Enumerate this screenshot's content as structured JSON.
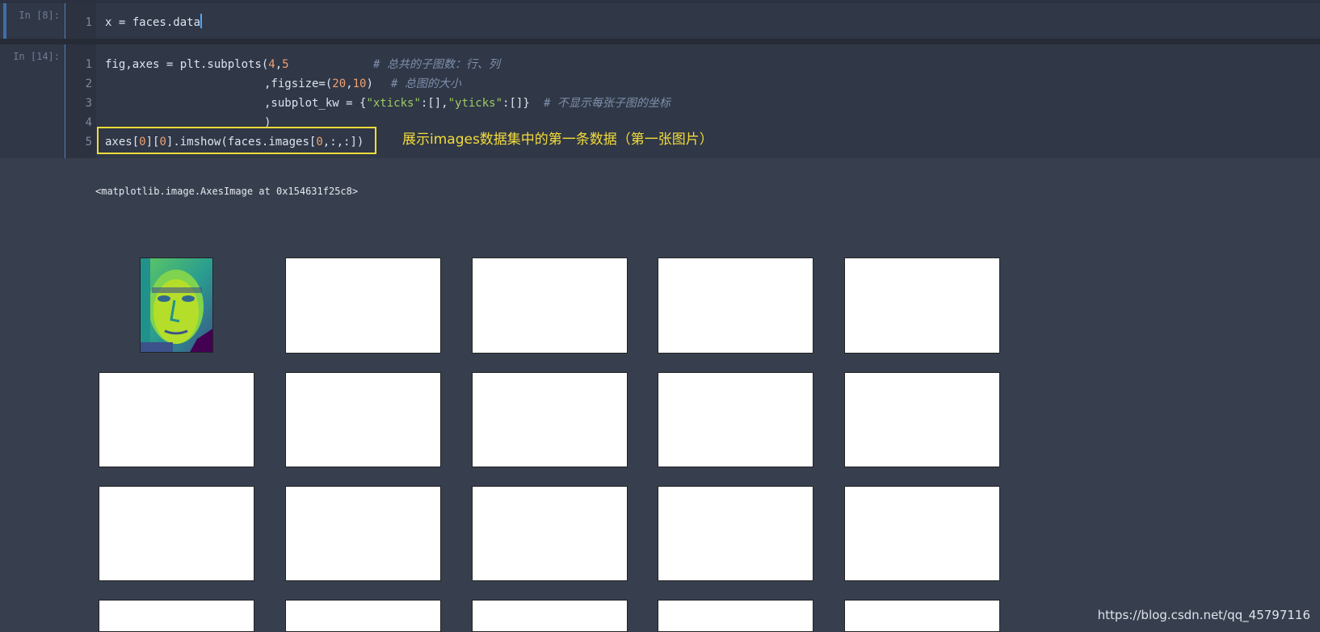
{
  "cells": [
    {
      "prompt": "In [8]:",
      "lines": [
        {
          "num": "1",
          "code": "x = faces.data"
        }
      ]
    },
    {
      "prompt": "In [14]:",
      "lines": [
        {
          "num": "1",
          "code_a": "fig,axes = plt.subplots(",
          "num_a": "4",
          "code_b": ",",
          "num_b": "5",
          "comment": "# 总共的子图数：行、列"
        },
        {
          "num": "2",
          "code_a": ",figsize=(",
          "num_a": "20",
          "code_b": ",",
          "num_b": "10",
          "code_c": ")",
          "comment": "# 总图的大小"
        },
        {
          "num": "3",
          "code_a": ",subplot_kw = {",
          "str_a": "\"xticks\"",
          "code_b": ":[],",
          "str_b": "\"yticks\"",
          "code_c": ":[]}",
          "comment": "# 不显示每张子图的坐标"
        },
        {
          "num": "4",
          "code": ")"
        },
        {
          "num": "5",
          "code_a": "axes[",
          "num_a": "0",
          "code_b": "][",
          "num_b": "0",
          "code_c": "].imshow(faces.images[",
          "num_c": "0",
          "code_d": ",:,:])"
        }
      ]
    }
  ],
  "annotation": "展示images数据集中的第一条数据（第一张图片）",
  "output_text": "<matplotlib.image.AxesImage at 0x154631f25c8>",
  "figure": {
    "rows": 4,
    "cols": 5,
    "first_image": "face-image"
  },
  "watermark": "https://blog.csdn.net/qq_45797116",
  "colors": {
    "background": "#373f4f",
    "cell": "#303746",
    "highlight": "#f3dc3a",
    "number": "#f0a070",
    "string": "#9ccc65",
    "comment": "#7e90ad"
  }
}
